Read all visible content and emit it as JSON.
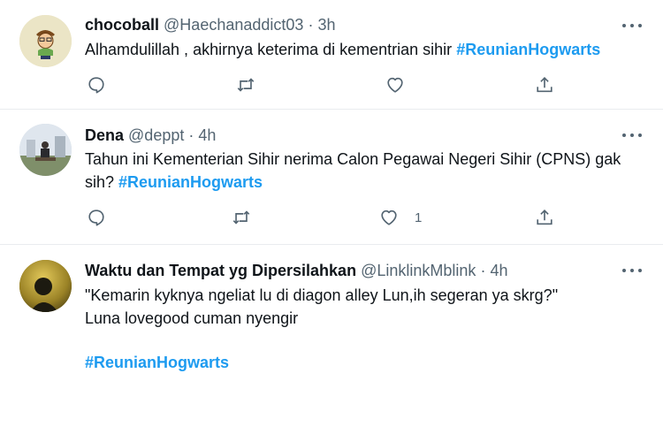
{
  "tweets": [
    {
      "name": "chocoball",
      "handle": "@Haechanaddict03",
      "dot": "·",
      "time": "3h",
      "text": "Alhamdulillah , akhirnya keterima di kementrian sihir ",
      "hashtag": "#ReunianHogwarts",
      "like_count": ""
    },
    {
      "name": "Dena",
      "handle": "@deppt",
      "dot": "·",
      "time": "4h",
      "text": "Tahun ini Kementerian Sihir nerima Calon Pegawai Negeri Sihir (CPNS) gak sih? ",
      "hashtag": "#ReunianHogwarts",
      "like_count": "1"
    },
    {
      "name": "Waktu dan Tempat yg Dipersilahkan",
      "handle": "@LinklinkMblink",
      "dot": "·",
      "time": "4h",
      "line1": "\"Kemarin kyknya ngeliat lu di diagon alley Lun,ih segeran ya skrg?\"",
      "line2": "Luna lovegood cuman nyengir",
      "hashtag": "#ReunianHogwarts"
    }
  ],
  "colors": {
    "hashtag": "#1d9bf0",
    "secondary": "#536471",
    "divider": "#e9ecef"
  },
  "icons": [
    "reply-icon",
    "retweet-icon",
    "like-icon",
    "share-icon",
    "more-icon"
  ]
}
